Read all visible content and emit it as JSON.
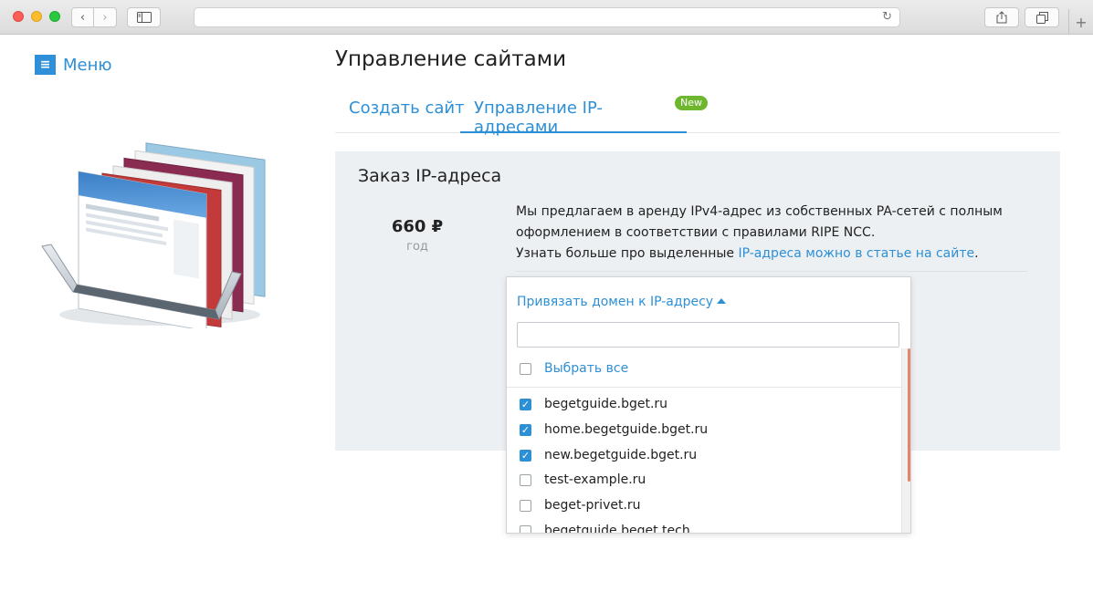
{
  "browser": {
    "back_icon": "‹",
    "forward_icon": "›",
    "sidebar_icon": "▭",
    "reload_icon": "↻",
    "share_icon": "⇪",
    "tabs_icon": "⧉",
    "newtab_icon": "+"
  },
  "menu": {
    "label": "Меню",
    "icon": "≡"
  },
  "page": {
    "title": "Управление сайтами"
  },
  "tabs": {
    "create": "Создать сайт",
    "ip": "Управление IP-адресами",
    "badge": "New"
  },
  "order": {
    "title": "Заказ IP-адреса",
    "price": "660 ₽",
    "period": "год",
    "desc_line1": "Мы предлагаем в аренду IPv4-адрес из собственных PA-сетей с полным",
    "desc_line2": "оформлением в соответствии с правилами RIPE NCC.",
    "desc_line3_prefix": "Узнать больше про выделенные ",
    "desc_link": "IP-адреса можно в статье на сайте",
    "desc_line3_suffix": "."
  },
  "dropdown": {
    "toggle_label": "Привязать домен к IP-адресу",
    "search_value": "",
    "select_all": "Выбрать все",
    "domains": [
      {
        "name": "begetguide.bget.ru",
        "checked": true
      },
      {
        "name": "home.begetguide.bget.ru",
        "checked": true
      },
      {
        "name": "new.begetguide.bget.ru",
        "checked": true
      },
      {
        "name": "test-example.ru",
        "checked": false
      },
      {
        "name": "beget-privet.ru",
        "checked": false
      },
      {
        "name": "begetguide.beget.tech",
        "checked": false
      }
    ]
  },
  "colors": {
    "accent": "#2d8fd5",
    "badge": "#6fb62f",
    "panel": "#edf0f3",
    "scroll": "#e5846c"
  }
}
